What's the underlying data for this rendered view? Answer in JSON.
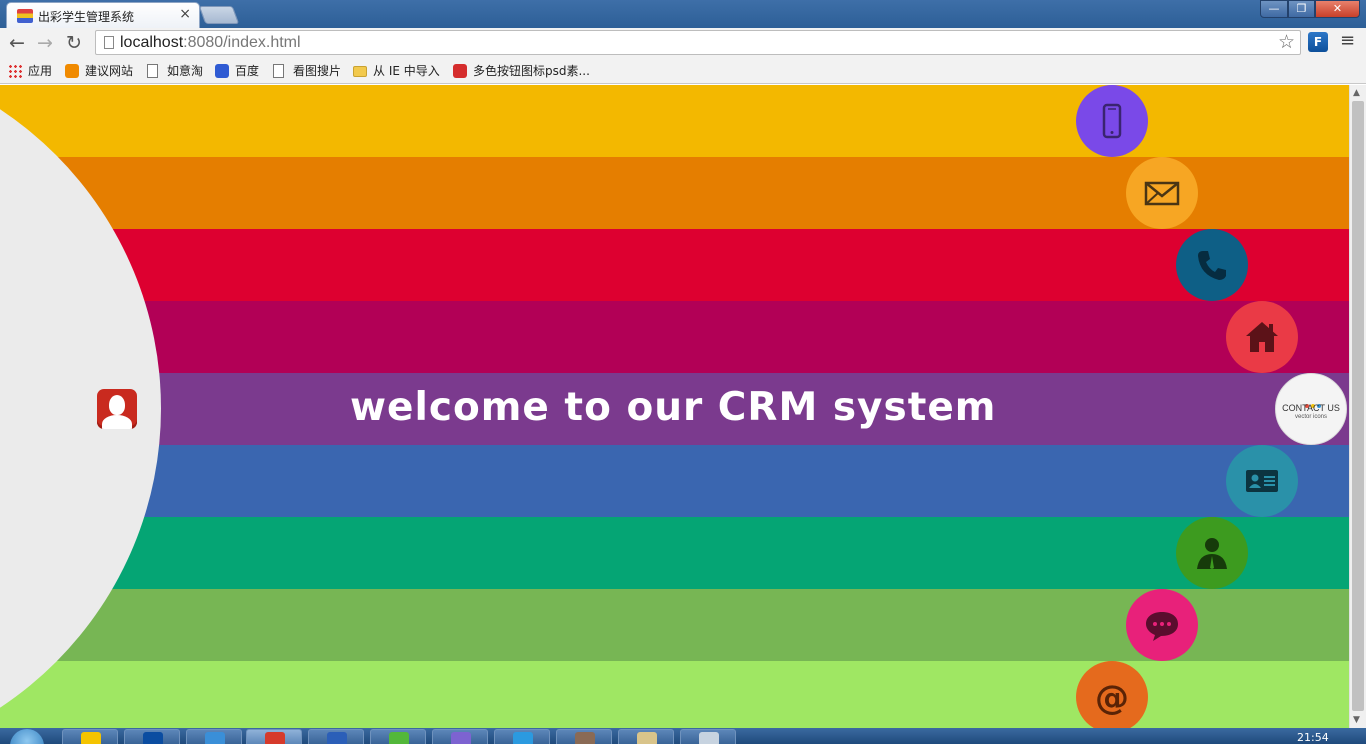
{
  "browser": {
    "tab_title": "出彩学生管理系统",
    "tab_close": "×",
    "url_host": "localhost",
    "url_path": ":8080/index.html",
    "extension_label": "F"
  },
  "bookmarks": [
    {
      "label": "应用",
      "icon": "apps-grid-icon"
    },
    {
      "label": "建议网站",
      "icon": "bulb-icon"
    },
    {
      "label": "如意淘",
      "icon": "page-icon"
    },
    {
      "label": "百度",
      "icon": "baidu-paw-icon"
    },
    {
      "label": "看图搜片",
      "icon": "page-icon"
    },
    {
      "label": "从 IE 中导入",
      "icon": "folder-icon"
    },
    {
      "label": "多色按钮图标psd素...",
      "icon": "psd-icon"
    }
  ],
  "page": {
    "welcome_text": "welcome to our CRM system",
    "stripe_colors": [
      "#f3b800",
      "#e57e00",
      "#dd0030",
      "#b20056",
      "#7b3a8e",
      "#3a66b0",
      "#05a574",
      "#77b654",
      "#9fe763"
    ],
    "contact": {
      "title": "CONTACT US",
      "subtitle": "vector icons",
      "dot_colors": [
        "#e74c3c",
        "#f1c40f",
        "#3498db"
      ]
    },
    "icons": [
      {
        "name": "mobile-phone-icon",
        "color": "#7a49e8"
      },
      {
        "name": "envelope-icon",
        "color": "#f7a623"
      },
      {
        "name": "telephone-icon",
        "color": "#0e5f86"
      },
      {
        "name": "home-icon",
        "color": "#ea3a46"
      },
      {
        "name": "contact-us-badge",
        "color": "#f4f4f4"
      },
      {
        "name": "id-card-icon",
        "color": "#2a91a9"
      },
      {
        "name": "user-icon",
        "color": "#3d9b1f"
      },
      {
        "name": "chat-bubble-icon",
        "color": "#e8217a"
      },
      {
        "name": "at-sign-icon",
        "color": "#e56a1d"
      }
    ]
  },
  "taskbar": {
    "clock": "21:54"
  }
}
